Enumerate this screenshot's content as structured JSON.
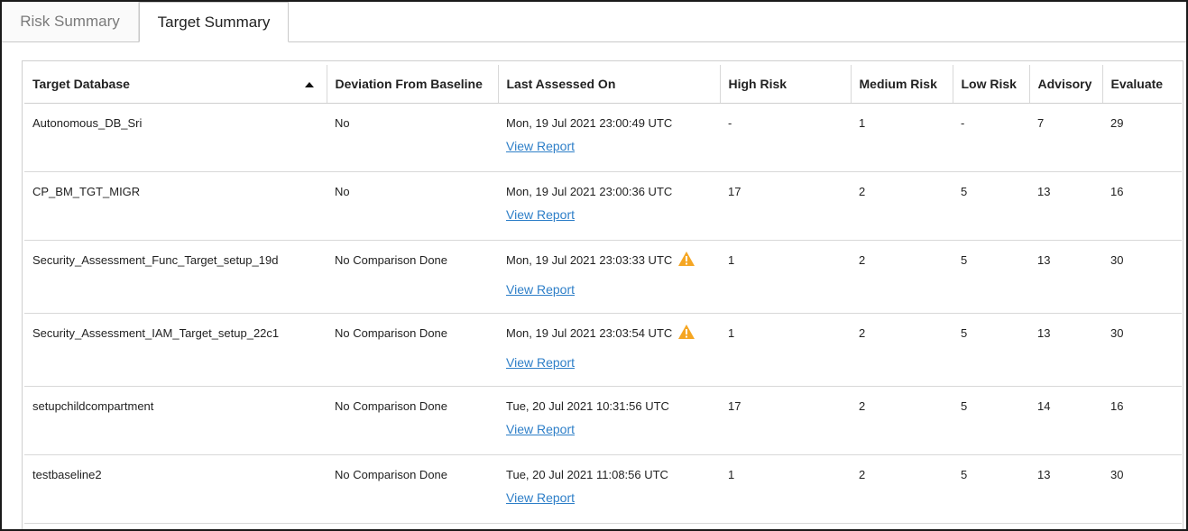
{
  "tabs": [
    {
      "label": "Risk Summary",
      "active": false
    },
    {
      "label": "Target Summary",
      "active": true
    }
  ],
  "table": {
    "columns": [
      "Target Database",
      "Deviation From Baseline",
      "Last Assessed On",
      "High Risk",
      "Medium Risk",
      "Low Risk",
      "Advisory",
      "Evaluate"
    ],
    "sort": {
      "column": "Target Database",
      "direction": "ascending",
      "icon": "sort-ascending-icon"
    },
    "rows": [
      {
        "target": "Autonomous_DB_Sri",
        "deviation": "No",
        "assessed": "Mon, 19 Jul 2021 23:00:49 UTC",
        "warning": false,
        "link": "View Report",
        "high": "-",
        "medium": "1",
        "low": "-",
        "advisory": "7",
        "evaluate": "29"
      },
      {
        "target": "CP_BM_TGT_MIGR",
        "deviation": "No",
        "assessed": "Mon, 19 Jul 2021 23:00:36 UTC",
        "warning": false,
        "link": "View Report",
        "high": "17",
        "medium": "2",
        "low": "5",
        "advisory": "13",
        "evaluate": "16"
      },
      {
        "target": "Security_Assessment_Func_Target_setup_19d",
        "deviation": "No Comparison Done",
        "assessed": "Mon, 19 Jul 2021 23:03:33 UTC",
        "warning": true,
        "link": "View Report",
        "high": "1",
        "medium": "2",
        "low": "5",
        "advisory": "13",
        "evaluate": "30"
      },
      {
        "target": "Security_Assessment_IAM_Target_setup_22c1",
        "deviation": "No Comparison Done",
        "assessed": "Mon, 19 Jul 2021 23:03:54 UTC",
        "warning": true,
        "link": "View Report",
        "high": "1",
        "medium": "2",
        "low": "5",
        "advisory": "13",
        "evaluate": "30"
      },
      {
        "target": "setupchildcompartment",
        "deviation": "No Comparison Done",
        "assessed": "Tue, 20 Jul 2021 10:31:56 UTC",
        "warning": false,
        "link": "View Report",
        "high": "17",
        "medium": "2",
        "low": "5",
        "advisory": "14",
        "evaluate": "16"
      },
      {
        "target": "testbaseline2",
        "deviation": "No Comparison Done",
        "assessed": "Tue, 20 Jul 2021 11:08:56 UTC",
        "warning": false,
        "link": "View Report",
        "high": "1",
        "medium": "2",
        "low": "5",
        "advisory": "13",
        "evaluate": "30"
      }
    ]
  },
  "colors": {
    "link": "#2e7fc8",
    "warning": "#f5a623",
    "border": "#cfcfcf"
  }
}
